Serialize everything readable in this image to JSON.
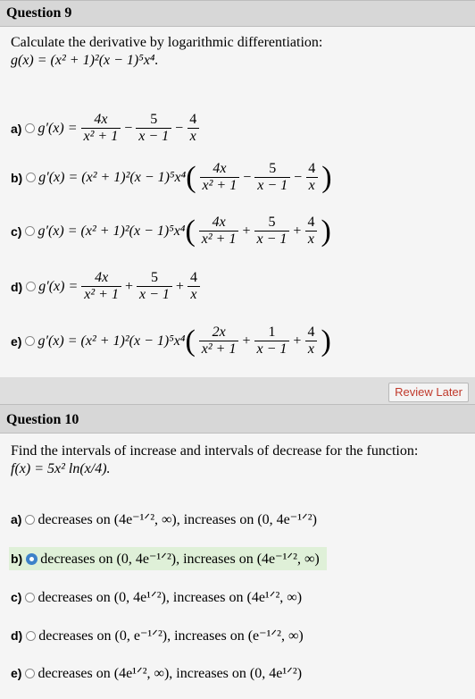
{
  "q9": {
    "title": "Question 9",
    "prompt": "Calculate the derivative by logarithmic differentiation:",
    "function": "g(x) = (x² + 1)²(x − 1)⁵x⁴.",
    "choices": [
      {
        "letter": "a)",
        "lhs": "g′(x) =",
        "t1n": "4x",
        "t1d": "x² + 1",
        "op1": "−",
        "t2n": "5",
        "t2d": "x − 1",
        "op2": "−",
        "t3n": "4",
        "t3d": "x"
      },
      {
        "letter": "b)",
        "lhs": "g′(x) = (x² + 1)²(x − 1)⁵x⁴",
        "t1n": "4x",
        "t1d": "x² + 1",
        "op1": "−",
        "t2n": "5",
        "t2d": "x − 1",
        "op2": "−",
        "t3n": "4",
        "t3d": "x"
      },
      {
        "letter": "c)",
        "lhs": "g′(x) = (x² + 1)²(x − 1)⁵x⁴",
        "t1n": "4x",
        "t1d": "x² + 1",
        "op1": "+",
        "t2n": "5",
        "t2d": "x − 1",
        "op2": "+",
        "t3n": "4",
        "t3d": "x"
      },
      {
        "letter": "d)",
        "lhs": "g′(x) =",
        "t1n": "4x",
        "t1d": "x² + 1",
        "op1": "+",
        "t2n": "5",
        "t2d": "x − 1",
        "op2": "+",
        "t3n": "4",
        "t3d": "x"
      },
      {
        "letter": "e)",
        "lhs": "g′(x) = (x² + 1)²(x − 1)⁵x⁴",
        "t1n": "2x",
        "t1d": "x² + 1",
        "op1": "+",
        "t2n": "1",
        "t2d": "x − 1",
        "op2": "+",
        "t3n": "4",
        "t3d": "x"
      }
    ],
    "review_label": "Review Later"
  },
  "q10": {
    "title": "Question 10",
    "prompt": "Find the intervals of increase and intervals of decrease for the function:",
    "function": "f(x) = 5x² ln(x/4).",
    "selected_index": 1,
    "choices": [
      {
        "letter": "a)",
        "text": "decreases on (4e⁻¹ᐟ², ∞),  increases on (0, 4e⁻¹ᐟ²)"
      },
      {
        "letter": "b)",
        "text": "decreases on (0, 4e⁻¹ᐟ²),  increases on (4e⁻¹ᐟ², ∞)"
      },
      {
        "letter": "c)",
        "text": "decreases on (0, 4e¹ᐟ²),  increases on (4e¹ᐟ², ∞)"
      },
      {
        "letter": "d)",
        "text": "decreases on (0, e⁻¹ᐟ²),  increases on (e⁻¹ᐟ², ∞)"
      },
      {
        "letter": "e)",
        "text": "decreases on (4e¹ᐟ², ∞),  increases on (0, 4e¹ᐟ²)"
      }
    ]
  },
  "colors": {
    "header": "#d7d7d7",
    "body": "#f5f5f5",
    "selected": "#dff0d8",
    "radio_on": "#3d82c9",
    "review_text": "#c0392b"
  }
}
